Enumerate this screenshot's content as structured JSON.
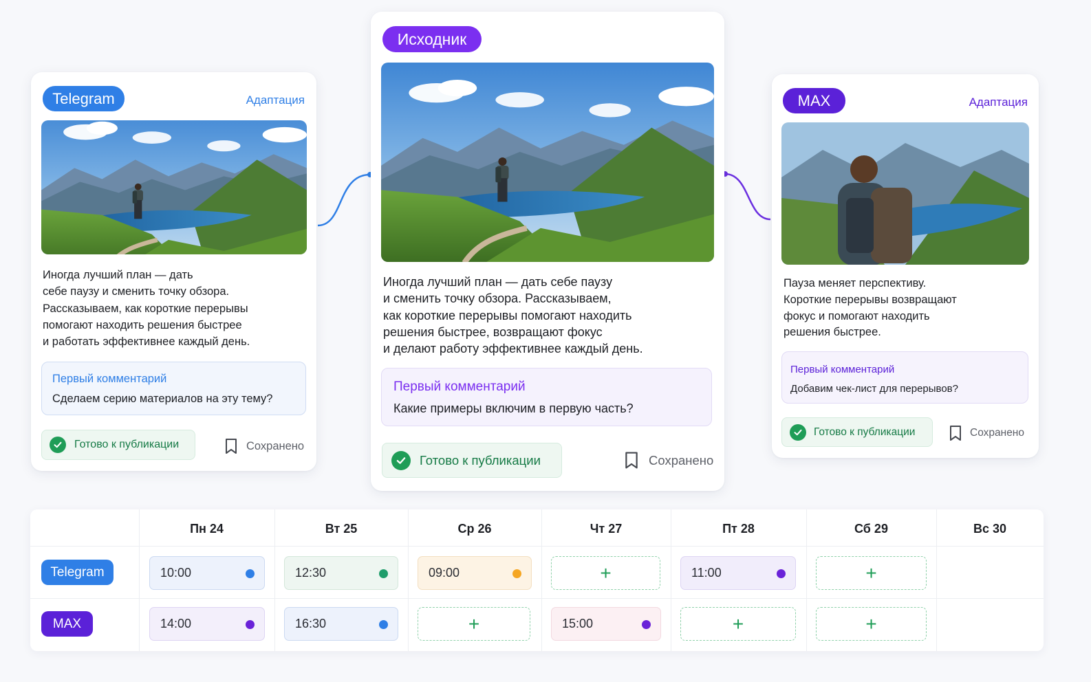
{
  "colors": {
    "telegram": "#2f7fe6",
    "max": "#5b21d8",
    "source": "#7b2ff0",
    "ready_green": "#1f9d57",
    "orange": "#f5a623"
  },
  "telegram_card": {
    "platform": "Telegram",
    "adapt_label": "Адаптация",
    "text": "Иногда лучший план — дать\nсебе паузу и сменить точку обзора.\nРассказываем, как короткие перерывы\nпомогают находить решения быстрее\nи работать эффективнее каждый день.",
    "comment_title": "Первый комментарий",
    "comment_text": "Сделаем серию материалов на эту тему?",
    "ready_label": "Готово к публикации",
    "saved_label": "Сохранено"
  },
  "source_card": {
    "badge": "Исходник",
    "text": "Иногда лучший план — дать себе паузу\nи сменить точку обзора. Рассказываем,\nкак короткие перерывы помогают находить\nрешения быстрее, возвращают фокус\nи делают работу эффективнее каждый день.",
    "comment_title": "Первый комментарий",
    "comment_text": "Какие примеры включим в первую часть?",
    "ready_label": "Готово к публикации",
    "saved_label": "Сохранено"
  },
  "max_card": {
    "platform": "MAX",
    "adapt_label": "Адаптация",
    "text": "Пауза меняет перспективу.\nКороткие перерывы возвращают\nфокус и помогают находить\nрешения быстрее.",
    "comment_title": "Первый комментарий",
    "comment_text": "Добавим чек-лист для перерывов?",
    "ready_label": "Готово к публикации",
    "saved_label": "Сохранено"
  },
  "schedule": {
    "days": [
      "Пн 24",
      "Вт 25",
      "Ср 26",
      "Чт 27",
      "Пт 28",
      "Сб 29",
      "Вс 30"
    ],
    "rows": [
      {
        "platform": "Telegram",
        "slots": [
          {
            "time": "10:00",
            "dot": "blue"
          },
          {
            "time": "12:30",
            "dot": "green"
          },
          {
            "time": "09:00",
            "dot": "orange"
          },
          {
            "time": "",
            "add": "+"
          },
          {
            "time": "11:00",
            "dot": "purple"
          },
          {
            "time": "",
            "add": "+"
          },
          {
            "time": ""
          }
        ]
      },
      {
        "platform": "MAX",
        "slots": [
          {
            "time": "14:00",
            "dot": "purple"
          },
          {
            "time": "16:30",
            "dot": "blue"
          },
          {
            "time": "",
            "add": "+"
          },
          {
            "time": "15:00",
            "dot": "purple"
          },
          {
            "time": "",
            "add": "+"
          },
          {
            "time": "",
            "add": "+"
          },
          {
            "time": ""
          }
        ]
      }
    ]
  }
}
